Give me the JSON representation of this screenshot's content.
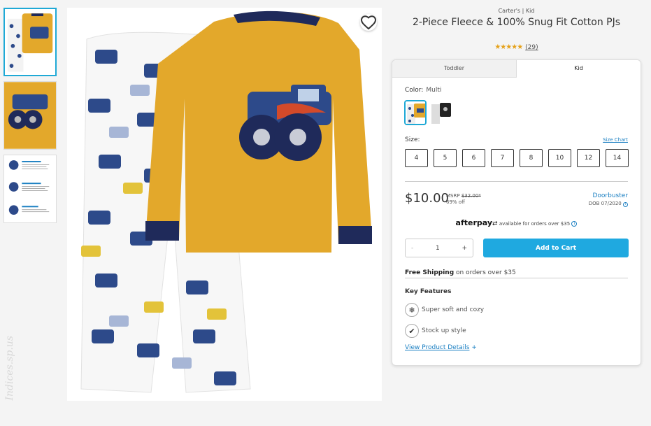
{
  "product": {
    "brand": "Carter's | Kid",
    "title": "2-Piece Fleece & 100% Snug Fit Cotton PJs",
    "stars": "★★★★★",
    "review_count": "(29)"
  },
  "tabs": [
    {
      "label": "Toddler",
      "active": false
    },
    {
      "label": "Kid",
      "active": true
    }
  ],
  "color": {
    "label": "Color:",
    "value": "Multi"
  },
  "size": {
    "label": "Size:",
    "chart_link": "Size Chart",
    "options": [
      "4",
      "5",
      "6",
      "7",
      "8",
      "10",
      "12",
      "14"
    ]
  },
  "pricing": {
    "price": "$10.00",
    "msrp_label": "MSRP",
    "msrp_value": "$32.00*",
    "discount": "69% off",
    "promo": "Doorbuster",
    "promo_date": "DOB 07/2020"
  },
  "afterpay": {
    "brand": "afterpay",
    "text": "available for orders over $35"
  },
  "cart": {
    "minus": "-",
    "quantity": "1",
    "plus": "+",
    "button": "Add to Cart"
  },
  "shipping": {
    "bold": "Free Shipping",
    "rest": "on orders over $35"
  },
  "key_features": {
    "title": "Key Features",
    "items": [
      {
        "label": "Super soft and cozy",
        "icon": "snowflake-icon"
      },
      {
        "label": "Stock up style",
        "icon": "check-icon"
      }
    ],
    "details_link": "View Product Details",
    "details_plus": "+"
  },
  "colors": {
    "accent": "#1fa9e0",
    "link": "#1a7fc2",
    "shirt": "#e3a82b",
    "navy": "#1f2a5a"
  },
  "watermark": "Indices.sp.us"
}
